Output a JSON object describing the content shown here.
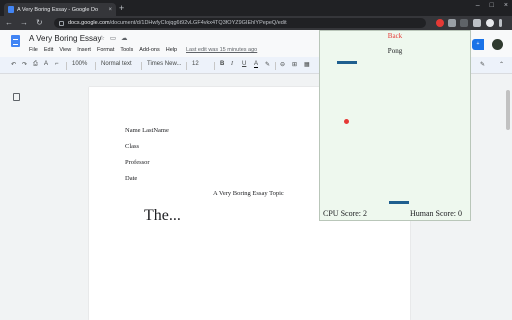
{
  "browser": {
    "tab_title": "A Very Boring Essay - Google Do",
    "tab_close": "×",
    "new_tab": "+",
    "window_controls": [
      "–",
      "□",
      "×"
    ],
    "url_domain": "docs.google.com",
    "url_path": "/document/d/1DHwfyCIojqg6t92vLGF4vkx4TQ3fOYZ9GIEhlYPepeQ/edit",
    "back_glyph": "←",
    "forward_glyph": "→",
    "reload_glyph": "↻",
    "icons": [
      "back-arrow-icon",
      "forward-arrow-icon",
      "reload-icon",
      "lock-icon"
    ]
  },
  "docs": {
    "title": "A Very Boring Essay",
    "star_glyph": "☆",
    "folder_glyph": "▭",
    "cloud_glyph": "☁",
    "menu": [
      "File",
      "Edit",
      "View",
      "Insert",
      "Format",
      "Tools",
      "Add-ons",
      "Help"
    ],
    "last_edit": "Last edit was 15 minutes ago",
    "share_glyph": "+",
    "toolbar": {
      "undo": "↶",
      "redo": "↷",
      "print": "⎙",
      "spell": "A",
      "paint": "⌐",
      "zoom": "100%",
      "style": "Normal text",
      "font": "Times New...",
      "size": "12",
      "bold": "B",
      "italic": "I",
      "underline": "U",
      "color": "A",
      "highlight": "✎",
      "link": "⊖",
      "comment": "⊞",
      "image": "▦",
      "edit": "✎",
      "collapse": "⌃"
    }
  },
  "document": {
    "lines": [
      "Name LastName",
      "Class",
      "Professor",
      "Date"
    ],
    "heading": "A Very Boring Essay Topic",
    "body": "The..."
  },
  "pong": {
    "back_label": "Back",
    "title": "Pong",
    "cpu_score_label": "CPU Score: 2",
    "human_score_label": "Human Score: 0"
  },
  "colors": {
    "accent": "#1a73e8",
    "pong_background": "#eef8ee",
    "paddle": "#1f5f8f",
    "ball": "#e53935"
  }
}
